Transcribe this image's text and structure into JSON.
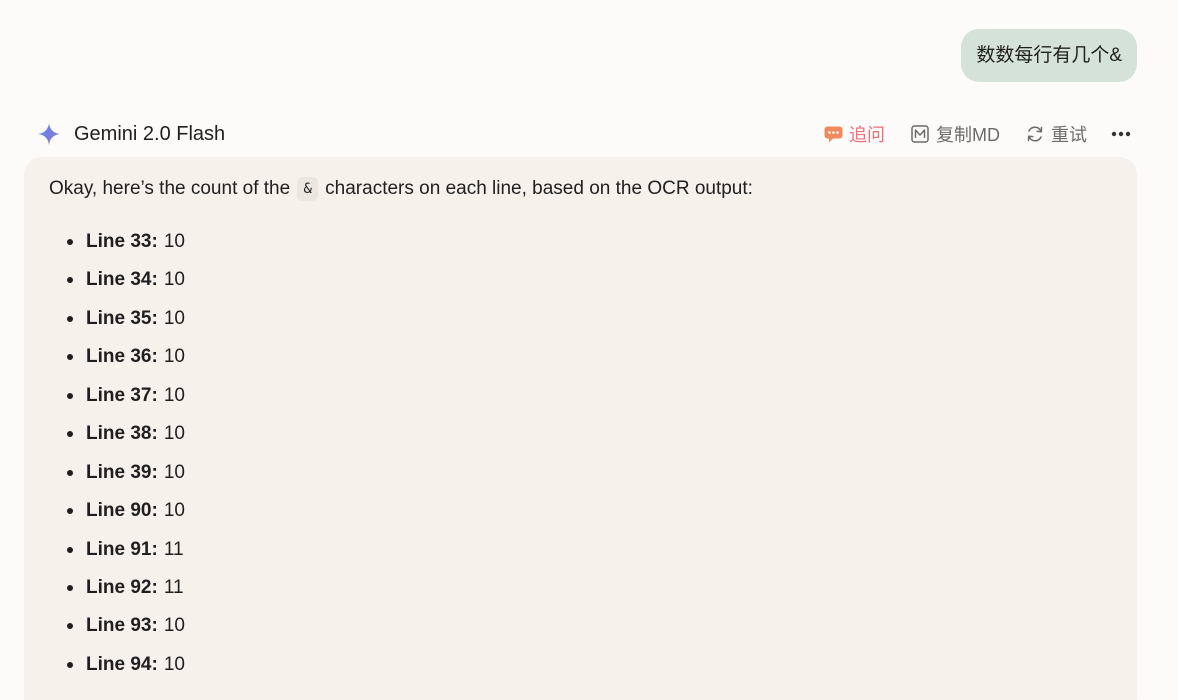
{
  "user_message": {
    "text": "数数每行有几个&"
  },
  "assistant": {
    "model_name": "Gemini 2.0 Flash",
    "model_icon": "sparkle-icon",
    "actions": {
      "followup_label": "追问",
      "copy_md_label": "复制MD",
      "retry_label": "重试",
      "more_icon": "ellipsis-icon"
    },
    "response": {
      "intro_before": "Okay, here’s the count of the",
      "intro_code": "&",
      "intro_after": "characters on each line, based on the OCR output:",
      "items": [
        {
          "label": "Line 33:",
          "count": "10"
        },
        {
          "label": "Line 34:",
          "count": "10"
        },
        {
          "label": "Line 35:",
          "count": "10"
        },
        {
          "label": "Line 36:",
          "count": "10"
        },
        {
          "label": "Line 37:",
          "count": "10"
        },
        {
          "label": "Line 38:",
          "count": "10"
        },
        {
          "label": "Line 39:",
          "count": "10"
        },
        {
          "label": "Line 90:",
          "count": "10"
        },
        {
          "label": "Line 91:",
          "count": "11"
        },
        {
          "label": "Line 92:",
          "count": "11"
        },
        {
          "label": "Line 93:",
          "count": "10"
        },
        {
          "label": "Line 94:",
          "count": "10"
        }
      ]
    }
  },
  "colors": {
    "page_bg": "#fcfbfa",
    "user_bubble_bg": "#d5e2d7",
    "card_bg": "#f6f1eb",
    "followup_accent": "#e8727a",
    "muted_text": "#6b6b6b"
  }
}
